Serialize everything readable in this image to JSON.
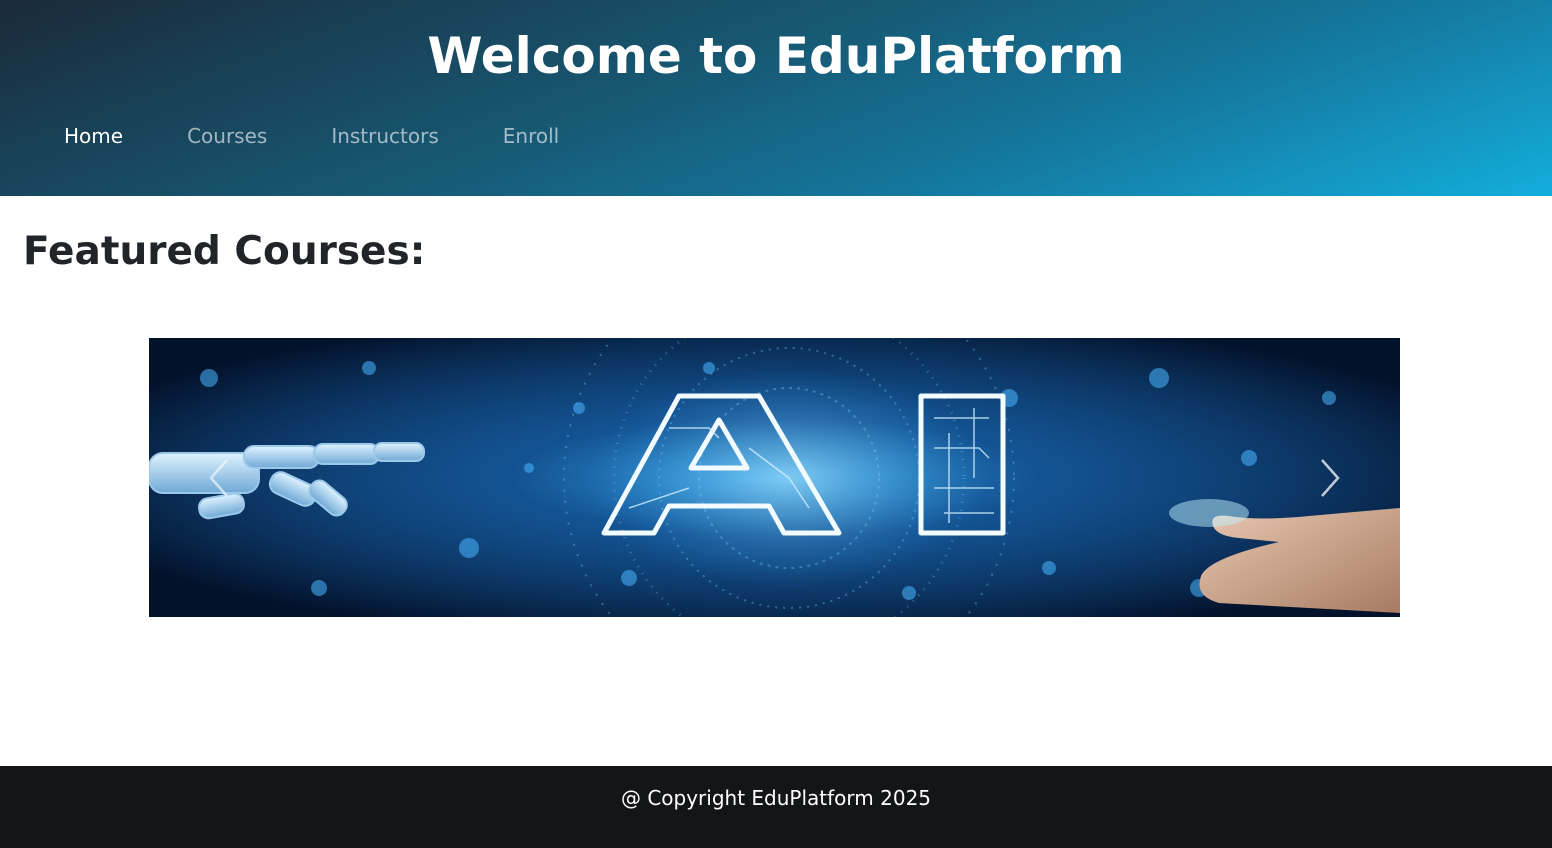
{
  "header": {
    "title": "Welcome to EduPlatform",
    "nav": [
      {
        "label": "Home",
        "active": true
      },
      {
        "label": "Courses",
        "active": false
      },
      {
        "label": "Instructors",
        "active": false
      },
      {
        "label": "Enroll",
        "active": false
      }
    ]
  },
  "main": {
    "section_title": "Featured Courses:",
    "carousel": {
      "slide_image": "ai-circuit-robot-hand-image",
      "slide_text": "AI",
      "prev_icon": "chevron-left-icon",
      "next_icon": "chevron-right-icon"
    }
  },
  "footer": {
    "text": "@ Copyright EduPlatform 2025"
  },
  "colors": {
    "header_start": "#1a2a3a",
    "header_end": "#13addb",
    "footer_bg": "#141519",
    "heading_text": "#212529"
  }
}
